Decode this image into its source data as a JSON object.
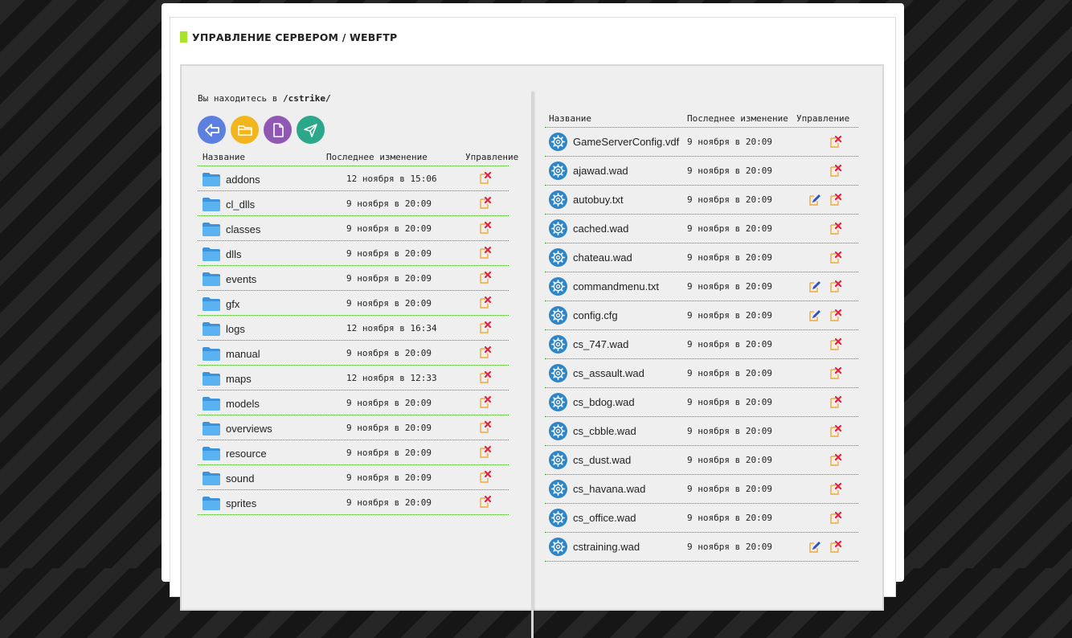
{
  "header": {
    "title": "УПРАВЛЕНИЕ СЕРВЕРОМ / WEBFTP"
  },
  "location": {
    "label": "Вы находитесь в",
    "path": "/cstrike/"
  },
  "toolbar": [
    {
      "icon": "back-arrow-icon",
      "color": "#5c7fe0"
    },
    {
      "icon": "new-folder-icon",
      "color": "#f2b51c"
    },
    {
      "icon": "new-file-icon",
      "color": "#8e58b3"
    },
    {
      "icon": "upload-send-icon",
      "color": "#2aa889"
    }
  ],
  "folders_table": {
    "columns": [
      "Название",
      "Последнее изменение",
      "Управление"
    ],
    "rows": [
      {
        "name": "addons",
        "modified": "12 ноября в 15:06"
      },
      {
        "name": "cl_dlls",
        "modified": "9 ноября в 20:09"
      },
      {
        "name": "classes",
        "modified": "9 ноября в 20:09"
      },
      {
        "name": "dlls",
        "modified": "9 ноября в 20:09"
      },
      {
        "name": "events",
        "modified": "9 ноября в 20:09"
      },
      {
        "name": "gfx",
        "modified": "9 ноября в 20:09"
      },
      {
        "name": "logs",
        "modified": "12 ноября в 16:34"
      },
      {
        "name": "manual",
        "modified": "9 ноября в 20:09"
      },
      {
        "name": "maps",
        "modified": "12 ноября в 12:33"
      },
      {
        "name": "models",
        "modified": "9 ноября в 20:09"
      },
      {
        "name": "overviews",
        "modified": "9 ноября в 20:09"
      },
      {
        "name": "resource",
        "modified": "9 ноября в 20:09"
      },
      {
        "name": "sound",
        "modified": "9 ноября в 20:09"
      },
      {
        "name": "sprites",
        "modified": "9 ноября в 20:09"
      }
    ]
  },
  "files_table": {
    "columns": [
      "Название",
      "Последнее изменение",
      "Управление"
    ],
    "rows": [
      {
        "name": "GameServerConfig.vdf",
        "modified": "9 ноября в 20:09",
        "editable": false
      },
      {
        "name": "ajawad.wad",
        "modified": "9 ноября в 20:09",
        "editable": false
      },
      {
        "name": "autobuy.txt",
        "modified": "9 ноября в 20:09",
        "editable": true
      },
      {
        "name": "cached.wad",
        "modified": "9 ноября в 20:09",
        "editable": false
      },
      {
        "name": "chateau.wad",
        "modified": "9 ноября в 20:09",
        "editable": false
      },
      {
        "name": "commandmenu.txt",
        "modified": "9 ноября в 20:09",
        "editable": true
      },
      {
        "name": "config.cfg",
        "modified": "9 ноября в 20:09",
        "editable": true
      },
      {
        "name": "cs_747.wad",
        "modified": "9 ноября в 20:09",
        "editable": false
      },
      {
        "name": "cs_assault.wad",
        "modified": "9 ноября в 20:09",
        "editable": false
      },
      {
        "name": "cs_bdog.wad",
        "modified": "9 ноября в 20:09",
        "editable": false
      },
      {
        "name": "cs_cbble.wad",
        "modified": "9 ноября в 20:09",
        "editable": false
      },
      {
        "name": "cs_dust.wad",
        "modified": "9 ноября в 20:09",
        "editable": false
      },
      {
        "name": "cs_havana.wad",
        "modified": "9 ноября в 20:09",
        "editable": false
      },
      {
        "name": "cs_office.wad",
        "modified": "9 ноября в 20:09",
        "editable": false
      },
      {
        "name": "cstraining.wad",
        "modified": "9 ноября в 20:09",
        "editable": true
      }
    ]
  },
  "colors": {
    "accent": "#a6e22e",
    "row_border": "#3ba21a",
    "folder": "#4aa3e8",
    "gear": "#2f86c6",
    "delete": "#e8213b",
    "edit": "#2f4fc4"
  }
}
